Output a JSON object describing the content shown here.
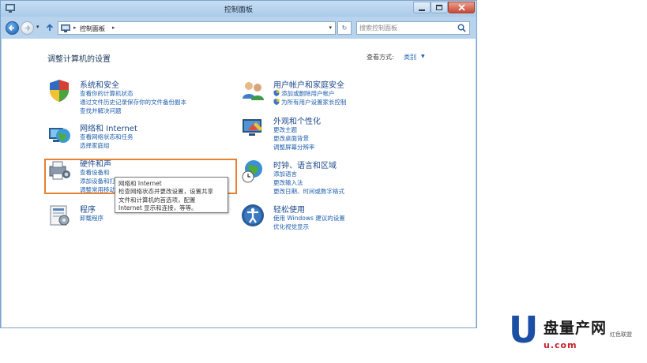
{
  "window": {
    "title": "控制面板"
  },
  "address": {
    "path": "控制面板",
    "search_placeholder": "搜索控制面板"
  },
  "content": {
    "title": "调整计算机的设置",
    "view_by_label": "查看方式:",
    "view_by_value": "类别"
  },
  "categories": {
    "system": {
      "title": "系统和安全",
      "links": [
        "查看你的计算机状态",
        "通过文件历史记录保存你的文件备份副本",
        "查找并解决问题"
      ]
    },
    "network": {
      "title": "网络和 Internet",
      "links": [
        "查看网络状态和任务",
        "选择家庭组"
      ]
    },
    "hardware": {
      "title": "硬件和声",
      "links": [
        "查看设备和",
        "添加设备和打印机",
        "调整常用移动设置"
      ]
    },
    "programs": {
      "title": "程序",
      "links": [
        "卸载程序"
      ]
    },
    "users": {
      "title": "用户帐户和家庭安全",
      "links": [
        "添加或删除用户帐户",
        "为所有用户设置家长控制"
      ]
    },
    "appearance": {
      "title": "外观和个性化",
      "links": [
        "更改主题",
        "更改桌面背景",
        "调整屏幕分辨率"
      ]
    },
    "clock": {
      "title": "时钟、语言和区域",
      "links": [
        "添加语言",
        "更改输入法",
        "更改日期、时间或数字格式"
      ]
    },
    "ease": {
      "title": "轻松使用",
      "links": [
        "使用 Windows 建议的设置",
        "优化视觉显示"
      ]
    }
  },
  "tooltip": {
    "lines": [
      "网络和 Internet",
      "检查网络状态并更改设置，设置共享",
      "文件和计算机的首选项，配置",
      "Internet 显示和连接，等等。"
    ]
  },
  "watermark": {
    "letter": "U",
    "brand": "盘量产网",
    "small": "红色联盟",
    "url": "u.com"
  },
  "colors": {
    "link": "#1f5fae",
    "heading": "#1e4a8c",
    "highlight": "#e8812f"
  }
}
